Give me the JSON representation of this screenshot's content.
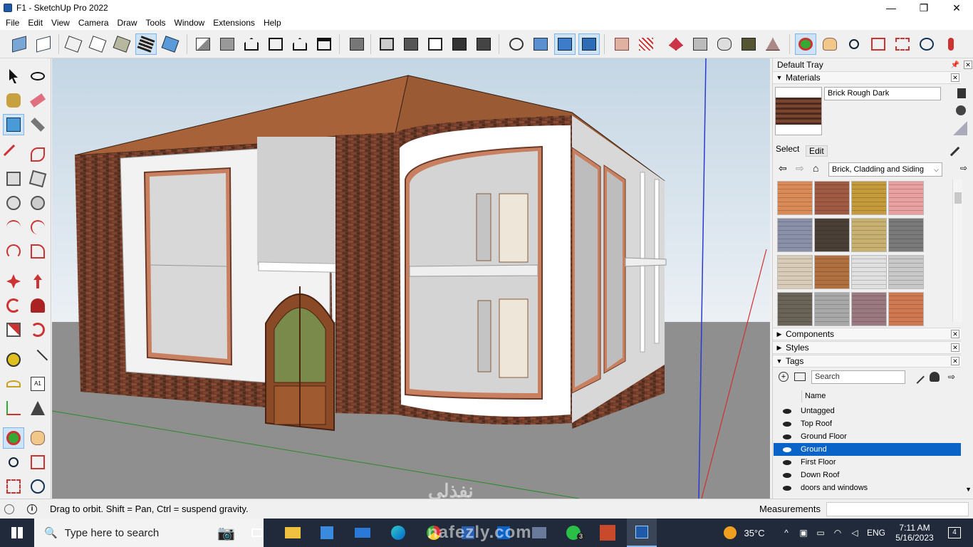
{
  "window": {
    "title": "F1 - SketchUp Pro 2022",
    "minimize": "—",
    "maximize": "❐",
    "close": "✕"
  },
  "menu": [
    "File",
    "Edit",
    "View",
    "Camera",
    "Draw",
    "Tools",
    "Window",
    "Extensions",
    "Help"
  ],
  "toolbar_icons": [
    "iso-view-icon",
    "top-view-icon",
    "front-view-icon",
    "right-view-icon",
    "back-view-icon",
    "left-view-icon",
    "bottom-view-icon",
    "xray-icon",
    "back-edges-icon",
    "wireframe-icon",
    "hidden-line-icon",
    "shaded-icon",
    "shaded-textures-icon",
    "monochrome-icon",
    "warehouse-icon",
    "extension-warehouse-icon",
    "house-icon",
    "section-plane-icon",
    "paint-icon",
    "camera-position-icon",
    "look-around-icon",
    "walk-icon",
    "section-display-icon",
    "section-cut-icon",
    "components-icon",
    "outliner-icon",
    "sandbox-icon",
    "smoove-icon",
    "stamp-icon",
    "drape-icon",
    "add-detail-icon",
    "flip-edge-icon",
    "orbit-icon",
    "pan-icon",
    "zoom-icon",
    "zoom-window-icon",
    "zoom-extents-icon",
    "previous-view-icon",
    "walk-person-icon"
  ],
  "tray": {
    "title": "Default Tray",
    "materials": {
      "header": "Materials",
      "current_name": "Brick Rough Dark",
      "tab_select": "Select",
      "tab_edit": "Edit",
      "library": "Brick, Cladding and Siding",
      "swatch_colors": [
        "#d98a56",
        "#a05a44",
        "#c49a3a",
        "#e8a0a0",
        "#8a90a8",
        "#4a4038",
        "#c8b070",
        "#7a7a7a",
        "#d8ccb8",
        "#b07040",
        "#e0e0e0",
        "#c8c8c8",
        "#6a6458",
        "#a8a8a8",
        "#9a7a80",
        "#d07850"
      ]
    },
    "components": "Components",
    "styles": "Styles",
    "tags": {
      "header": "Tags",
      "search_placeholder": "Search",
      "col_name": "Name",
      "rows": [
        "Untagged",
        "Top Roof",
        "Ground Floor",
        "Ground",
        "First Floor",
        "Down Roof",
        "doors and windows"
      ],
      "selected": "Ground"
    }
  },
  "status": {
    "message": "Drag to orbit. Shift = Pan, Ctrl = suspend gravity.",
    "measurements_label": "Measurements",
    "measurements_value": ""
  },
  "taskbar": {
    "search_placeholder": "Type here to search",
    "temperature": "35°C",
    "language": "ENG",
    "time": "7:11 AM",
    "date": "5/16/2023",
    "notifications": "4",
    "whatsapp_badge": "3"
  },
  "watermark": {
    "latin": "nafezly.com",
    "arabic": "نفذلي"
  }
}
